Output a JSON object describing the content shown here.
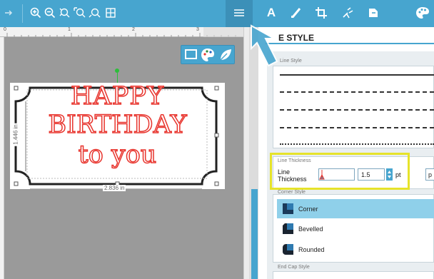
{
  "toolbar": {
    "left_icons": [
      "arrow-right-icon",
      "zoom-in-icon",
      "zoom-out-icon",
      "zoom-select-icon",
      "zoom-page-icon",
      "zoom-fit-icon",
      "grid-icon"
    ],
    "right_icons": [
      "line-style-icon",
      "text-icon",
      "edit-points-icon",
      "crop-icon",
      "trace-icon",
      "export-icon",
      "color-icon"
    ],
    "text_icon_label": "A"
  },
  "canvas": {
    "ruler_marks": [
      "0",
      "1",
      "2",
      "3"
    ],
    "design": {
      "line1": "HAPPY",
      "line2": "BIRTHDAY",
      "line3": "to you",
      "width_label": "2.836 in",
      "height_label": "1.446 in",
      "text_color": "#e8342d"
    },
    "panel_toggles": [
      "fill-panel-icon",
      "palette-icon",
      "leaf-icon"
    ]
  },
  "panel": {
    "title": "E STYLE",
    "line_style_label": "Line Style",
    "line_thickness_section": "Line Thickness",
    "line_thickness_label_1": "Line",
    "line_thickness_label_2": "Thickness",
    "line_thickness_value": "1.5",
    "line_thickness_unit": "pt",
    "line_thickness_extra": "p",
    "corner_style_label": "Corner Style",
    "corner_options": [
      "Corner",
      "Bevelled",
      "Rounded"
    ],
    "end_cap_label": "End Cap Style"
  },
  "colors": {
    "accent": "#47a5cf",
    "highlight": "#e6e32a",
    "design_red": "#e8342d"
  }
}
